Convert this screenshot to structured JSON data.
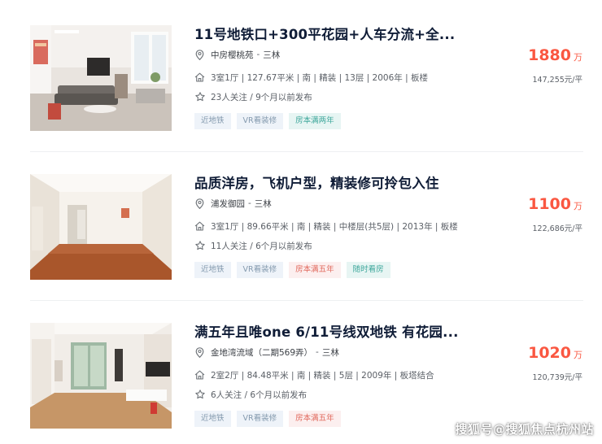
{
  "listings": [
    {
      "title": "11号地铁口+300平花园+人车分流+全...",
      "community": "中房樱桃苑",
      "district": "三林",
      "details": "3室1厅 | 127.67平米 | 南 | 精装 | 13层 | 2006年 | 板楼",
      "follow": "23人关注 / 9个月以前发布",
      "tags": [
        "近地铁",
        "VR看装修",
        "房本满两年"
      ],
      "price": "1880",
      "price_unit": "万",
      "unit_price": "147,255元/平"
    },
    {
      "title": "品质洋房，飞机户型，精装修可拎包入住",
      "community": "浦发御园",
      "district": "三林",
      "details": "3室1厅 | 89.66平米 | 南 | 精装 | 中楼层(共5层) | 2013年 | 板楼",
      "follow": "11人关注 / 6个月以前发布",
      "tags": [
        "近地铁",
        "VR看装修",
        "房本满五年",
        "随时看房"
      ],
      "price": "1100",
      "price_unit": "万",
      "unit_price": "122,686元/平"
    },
    {
      "title": "满五年且唯one 6/11号线双地铁 有花园...",
      "community": "金地湾流域（二期569弄）",
      "district": "三林",
      "details": "2室2厅 | 84.48平米 | 南 | 精装 | 5层 | 2009年 | 板塔结合",
      "follow": "6人关注 / 6个月以前发布",
      "tags": [
        "近地铁",
        "VR看装修",
        "房本满五年"
      ],
      "price": "1020",
      "price_unit": "万",
      "unit_price": "120,739元/平"
    }
  ],
  "separator": "-",
  "icons": {
    "location": "location-pin-icon",
    "house": "house-icon",
    "follow": "star-icon"
  },
  "colors": {
    "price": "#fa5741",
    "title": "#101d37",
    "tag_blue_bg": "#eef3f9",
    "tag_red_bg": "#fcefef",
    "tag_teal_bg": "#e7f5f3"
  },
  "watermark": "搜狐号@搜狐焦点杭州站"
}
